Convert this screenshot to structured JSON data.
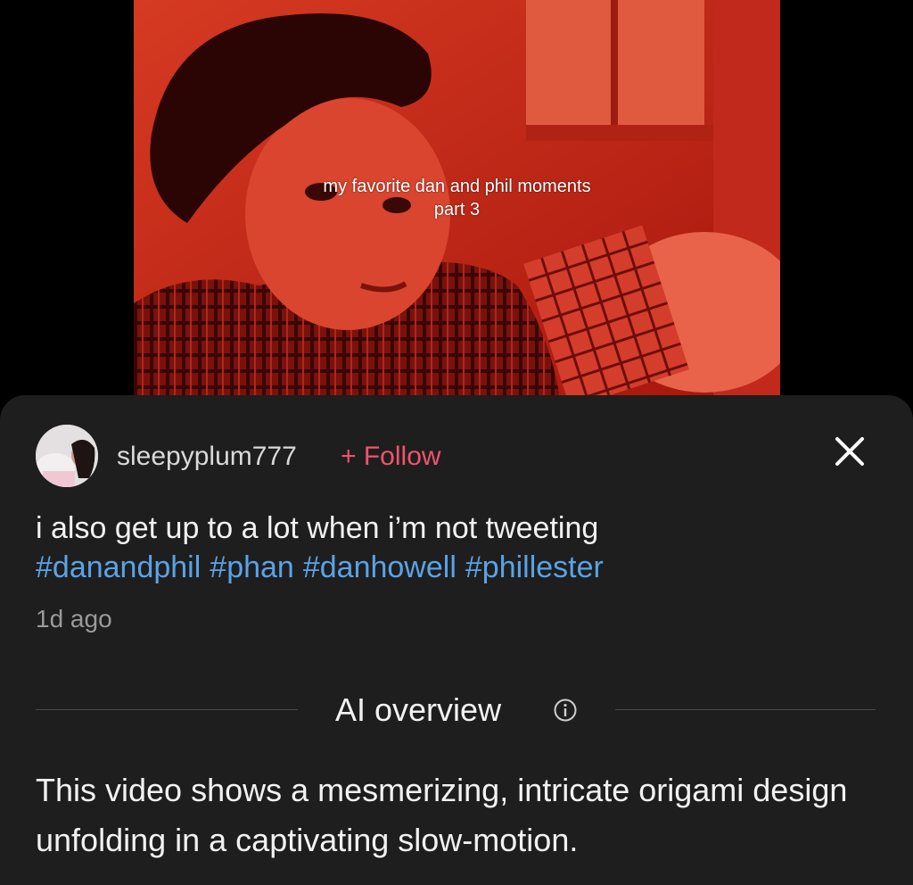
{
  "video": {
    "caption_line1": "my favorite dan and phil moments",
    "caption_line2": "part 3"
  },
  "post": {
    "username": "sleepyplum777",
    "follow_label": "+ Follow",
    "caption_text": "i also get up to a lot when i’m not tweeting",
    "hashtags": [
      "#danandphil",
      "#phan",
      "#danhowell",
      "#phillester"
    ],
    "time_ago": "1d ago"
  },
  "ai_overview": {
    "title": "AI overview",
    "text": "This video shows a mesmerizing, intricate origami design unfolding in a captivating slow-motion."
  },
  "icons": {
    "close": "close-icon",
    "info": "info-icon"
  },
  "colors": {
    "sheet_background": "#1e1e1e",
    "follow": "#f0546b",
    "hashtag": "#5aa3e6",
    "video_tint": "#c8281c"
  }
}
